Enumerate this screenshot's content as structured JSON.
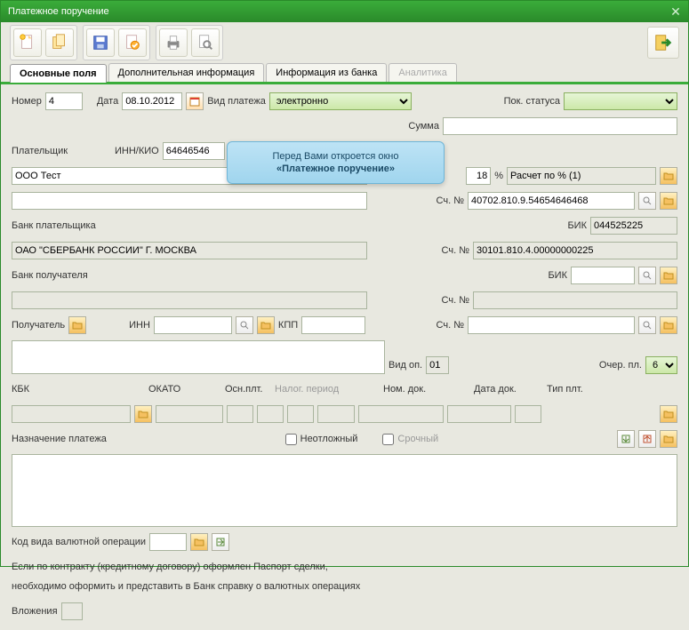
{
  "title": "Платежное поручение",
  "tabs": [
    "Основные поля",
    "Дополнительная информация",
    "Информация из банка",
    "Аналитика"
  ],
  "r1": {
    "nomer_l": "Номер",
    "nomer": "4",
    "data_l": "Дата",
    "data": "08.10.2012",
    "vid_l": "Вид платежа",
    "vid": "электронно",
    "status_l": "Пок. статуса"
  },
  "r2": {
    "summa_l": "Сумма"
  },
  "r3": {
    "plat_l": "Плательщик",
    "inn_l": "ИНН/КИО",
    "inn": "64646546"
  },
  "r4": {
    "name": "ООО Тест",
    "pct": "18",
    "pct_s": "%",
    "rasch": "Расчет по % (1)"
  },
  "r5": {
    "sch_l": "Сч. №",
    "sch": "40702.810.9.54654646468"
  },
  "r6": {
    "bank_l": "Банк плательщика",
    "bik_l": "БИК",
    "bik": "044525225"
  },
  "r7": {
    "bank": "ОАО \"СБЕРБАНК РОССИИ\" Г. МОСКВА",
    "sch_l": "Сч. №",
    "sch": "30101.810.4.00000000225"
  },
  "r8": {
    "bank_l": "Банк получателя",
    "bik_l": "БИК"
  },
  "r9": {
    "sch_l": "Сч. №"
  },
  "r10": {
    "pol_l": "Получатель",
    "inn_l": "ИНН",
    "kpp_l": "КПП",
    "sch_l": "Сч. №"
  },
  "r11": {
    "vid_l": "Вид оп.",
    "vid": "01",
    "ocher_l": "Очер. пл.",
    "ocher": "6"
  },
  "r12": {
    "kbk_l": "КБК",
    "okato_l": "ОКАТО",
    "osn_l": "Осн.плт.",
    "nalog_ph": "Налог. период",
    "nom_l": "Ном. док.",
    "datad_l": "Дата док.",
    "tip_l": "Тип плт."
  },
  "r13": {
    "nazn_l": "Назначение платежа",
    "neot": "Неотложный",
    "sroch": "Срочный"
  },
  "r14": {
    "kod_l": "Код вида валютной операции"
  },
  "note1": "Если по контракту (кредитному договору) оформлен Паспорт сделки,",
  "note2": "необходимо оформить и представить в Банк справку о валютных операциях",
  "vlozh": "Вложения",
  "tip": {
    "l1": "Перед Вами откроется окно",
    "l2": "«Платежное поручение»"
  }
}
